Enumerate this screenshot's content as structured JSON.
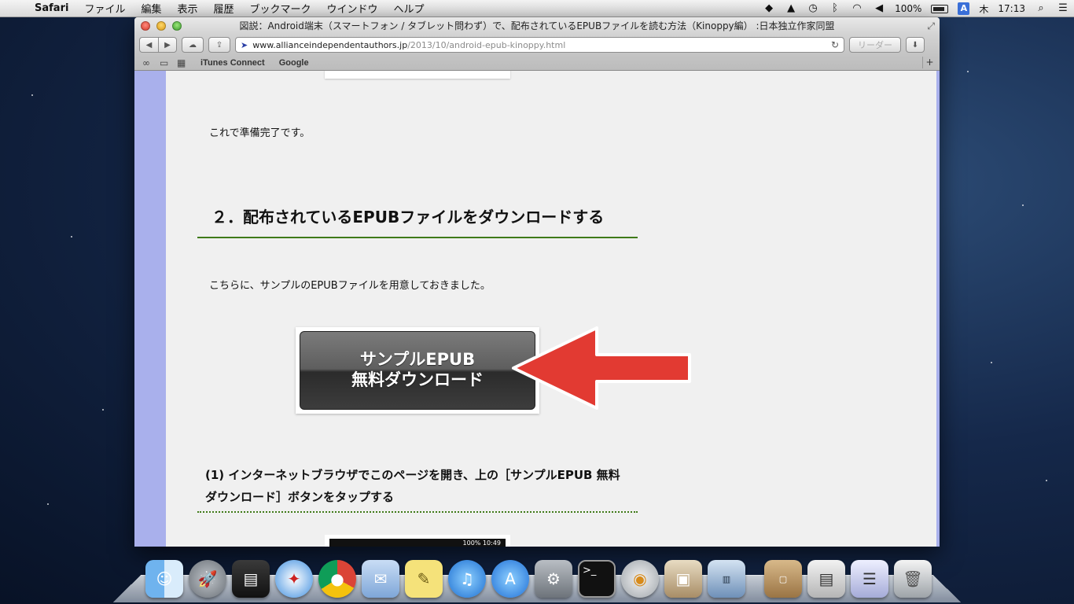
{
  "menubar": {
    "app_name": "Safari",
    "items": [
      "ファイル",
      "編集",
      "表示",
      "履歴",
      "ブックマーク",
      "ウインドウ",
      "ヘルプ"
    ],
    "battery": "100%",
    "day": "木",
    "time": "17:13",
    "input_source": "A"
  },
  "window": {
    "title": "図説：Android端末（スマートフォン / タブレット問わず）で、配布されているEPUBファイルを読む方法（Kinoppy編） :日本独立作家同盟",
    "url_host": "www.allianceindependentauthors.jp",
    "url_path": "/2013/10/android-epub-kinoppy.html",
    "reader_label": "リーダー",
    "bookmarks": [
      "iTunes Connect",
      "Google"
    ]
  },
  "page": {
    "ready_text": "これで準備完了です。",
    "heading": "２．配布されているEPUBファイルをダウンロードする",
    "intro_text": "こちらに、サンプルのEPUBファイルを用意しておきました。",
    "download_line1": "サンプルEPUB",
    "download_line2": "無料ダウンロード",
    "step_heading": "(1) インターネットブラウザでこのページを開き、上の［サンプルEPUB 無料ダウンロード］ボタンをタップする",
    "phone_status": "100% 10:49"
  },
  "dock": {
    "apps": [
      "finder",
      "launchpad",
      "photo-booth",
      "safari",
      "chrome",
      "mail",
      "stickies",
      "itunes",
      "app-store",
      "system-preferences",
      "terminal",
      "dvd-player",
      "preview",
      "books"
    ],
    "stacks": [
      "air-folder",
      "downloads",
      "documents",
      "trash"
    ]
  },
  "colors": {
    "accent_stripe": "#a9b0ec",
    "heading_rule": "#3f7a18",
    "arrow": "#e23a32"
  }
}
